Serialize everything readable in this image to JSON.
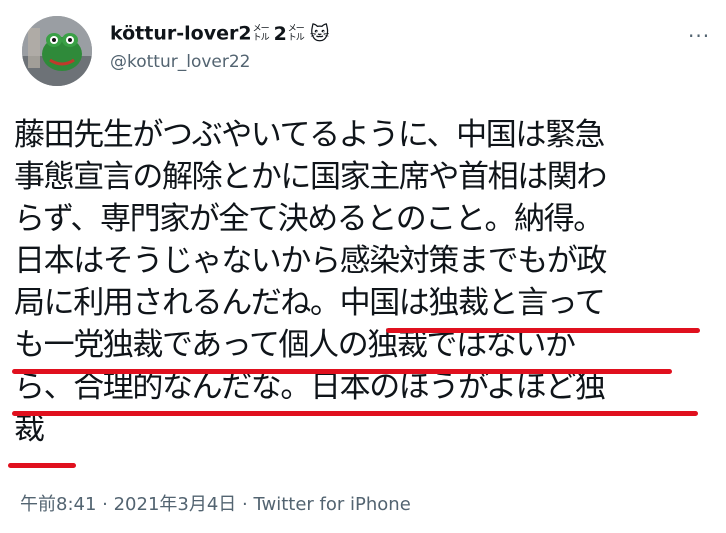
{
  "user": {
    "display_name": "köttur-lover2",
    "name_meter_top": "メー",
    "name_meter_bottom": "トル",
    "name_number2": "2",
    "name_meter2_top": "メー",
    "name_meter2_bottom": "トル",
    "name_emoji": "🐱",
    "handle": "@kottur_lover22"
  },
  "more_icon": "···",
  "tweet": {
    "lines": [
      "藤田先生がつぶやいてるように、中国は緊急",
      "事態宣言の解除とかに国家主席や首相は関わ",
      "らず、専門家が全て決めるとのこと。納得。",
      "日本はそうじゃないから感染対策までもが政",
      "局に利用されるんだね。中国は独裁と言って",
      "も一党独裁であって個人の独裁ではないか",
      "ら、合理的なんだな。日本のほうがよほど独",
      "裁"
    ]
  },
  "footer": {
    "time": "午前8:41",
    "separator": " · ",
    "date": "2021年3月4日",
    "source": "Twitter for iPhone"
  },
  "colors": {
    "text": "#0f1419",
    "secondary": "#536471",
    "underline": "#e0101e"
  }
}
